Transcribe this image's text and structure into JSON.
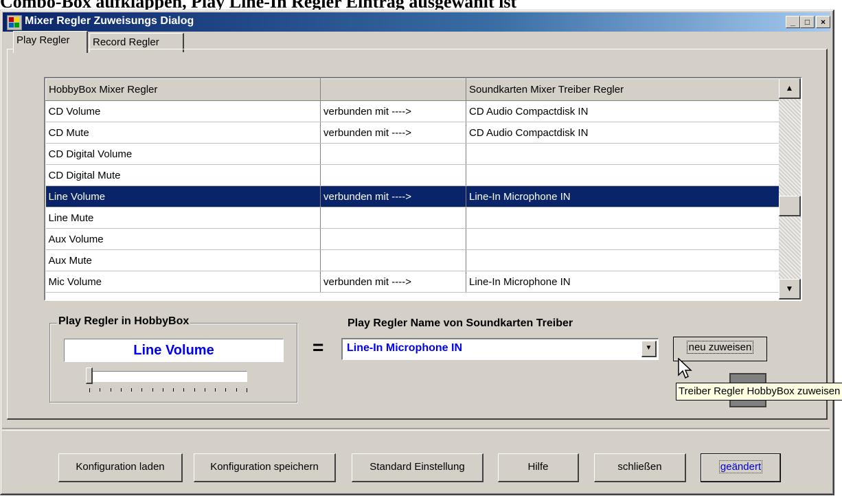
{
  "doc_strip_text": "Combo-Box aufklappen, Play Line-In Regler Eintrag ausgewählt ist",
  "window": {
    "title": "Mixer Regler  Zuweisungs  Dialog",
    "controls": {
      "minimize": "_",
      "maximize": "□",
      "close": "×"
    }
  },
  "tabs": [
    {
      "label": "Play Regler",
      "active": true
    },
    {
      "label": "Record Regler",
      "active": false
    }
  ],
  "grid": {
    "columns": [
      "HobbyBox Mixer Regler",
      "",
      "Soundkarten Mixer Treiber Regler"
    ],
    "rows": [
      {
        "hobbybox": "CD Volume",
        "link": "verbunden mit ---->",
        "driver": "CD Audio Compactdisk IN",
        "selected": false
      },
      {
        "hobbybox": "CD Mute",
        "link": "verbunden mit ---->",
        "driver": "CD Audio Compactdisk IN",
        "selected": false
      },
      {
        "hobbybox": "CD Digital Volume",
        "link": "",
        "driver": "",
        "selected": false
      },
      {
        "hobbybox": "CD Digital Mute",
        "link": "",
        "driver": "",
        "selected": false
      },
      {
        "hobbybox": "Line Volume",
        "link": "verbunden mit ---->",
        "driver": "Line-In Microphone IN",
        "selected": true
      },
      {
        "hobbybox": "Line Mute",
        "link": "",
        "driver": "",
        "selected": false
      },
      {
        "hobbybox": "Aux Volume",
        "link": "",
        "driver": "",
        "selected": false
      },
      {
        "hobbybox": "Aux Mute",
        "link": "",
        "driver": "",
        "selected": false
      },
      {
        "hobbybox": "Mic Volume",
        "link": "verbunden mit ---->",
        "driver": "Line-In Microphone IN",
        "selected": false
      }
    ],
    "scroll_up_icon": "▲",
    "scroll_down_icon": "▼"
  },
  "play_box": {
    "legend": "Play  Regler in  HobbyBox",
    "value": "Line Volume",
    "slider_level": 0
  },
  "equals_sign": "=",
  "driver_combo": {
    "label": "Play Regler Name von Soundkarten Treiber",
    "value": "Line-In Microphone IN",
    "dropdown_icon": "▼"
  },
  "assign_button": "neu zuweisen",
  "tooltip": "Treiber Regler HobbyBox zuweisen",
  "bottom_buttons": {
    "load": "Konfiguration laden",
    "save": "Konfiguration speichern",
    "default": "Standard Einstellung",
    "help": "Hilfe",
    "close": "schließen",
    "changed": "geändert"
  },
  "colors": {
    "title_bar_start": "#0a246a",
    "title_bar_end": "#a6caf0",
    "window_bg": "#d4d0c8",
    "selection": "#0a246a",
    "value_text": "#0000ee",
    "tooltip_bg": "#ffffe1"
  }
}
